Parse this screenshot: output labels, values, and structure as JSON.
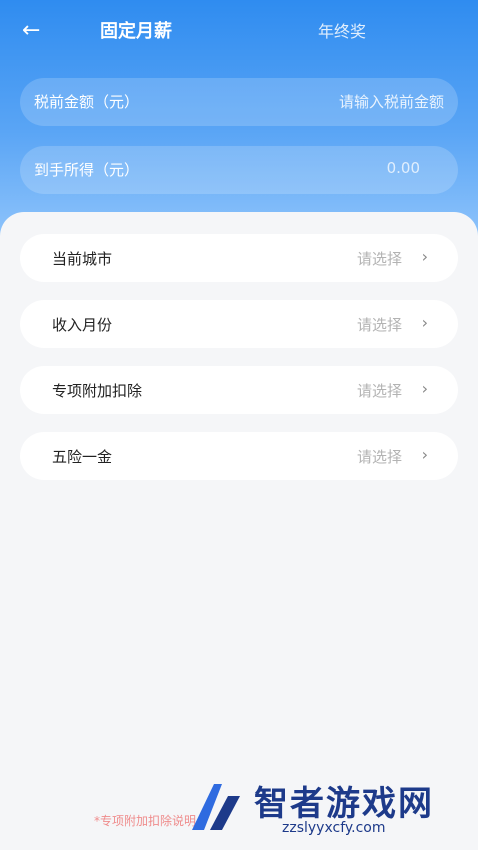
{
  "nav": {
    "active_tab": "固定月薪",
    "other_tab": "年终奖"
  },
  "fields": {
    "pretax": {
      "label": "税前金额（元）",
      "placeholder": "请输入税前金额"
    },
    "net": {
      "label": "到手所得（元）",
      "value": "0.00"
    }
  },
  "rows": [
    {
      "name": "当前城市",
      "hint": "请选择"
    },
    {
      "name": "收入月份",
      "hint": "请选择"
    },
    {
      "name": "专项附加扣除",
      "hint": "请选择"
    },
    {
      "name": "五险一金",
      "hint": "请选择"
    }
  ],
  "footer": {
    "note": "*专项附加扣除说明"
  },
  "watermark": {
    "title": "智者游戏网",
    "url": "zzslyyxcfy.com"
  },
  "colors": {
    "primary": "#2f8cf0",
    "muted": "#b3b3b3"
  }
}
